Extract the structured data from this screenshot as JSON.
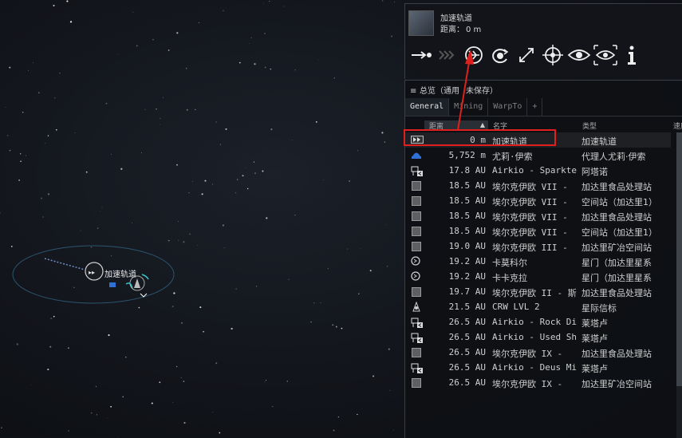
{
  "scene": {
    "label": "加速轨道"
  },
  "selected_item": {
    "name": "加速轨道",
    "distance_label": "距离：",
    "distance_value": "0 m",
    "actions": [
      {
        "name": "approach-icon"
      },
      {
        "name": "align-to-icon"
      },
      {
        "name": "warp-to-icon"
      },
      {
        "name": "orbit-icon"
      },
      {
        "name": "keep-at-range-icon"
      },
      {
        "name": "lock-target-icon"
      },
      {
        "name": "look-at-icon"
      },
      {
        "name": "show-info-eye-icon"
      },
      {
        "name": "info-icon"
      }
    ]
  },
  "overview": {
    "title_prefix": "总览（通用",
    "title_suffix": "未保存）",
    "tabs": [
      "General",
      "Mining",
      "WarpTo",
      "+"
    ],
    "columns": {
      "distance": "距离",
      "name": "名字",
      "type": "类型",
      "speed": "速度"
    },
    "rows": [
      {
        "icon": "acceleration-gate-icon",
        "distance": "0 m",
        "name": "加速轨道",
        "type": "加速轨道"
      },
      {
        "icon": "agent-icon",
        "distance": "5,752 m",
        "name": "尤莉·伊索",
        "type": "代理人尤莉·伊索"
      },
      {
        "icon": "station-structure-icon",
        "distance": "17.8 AU",
        "name": "Airkio - Sparktek In",
        "type": "阿塔诺"
      },
      {
        "icon": "square-icon",
        "distance": "18.5 AU",
        "name": "埃尔克伊欧 VII -",
        "type": "加达里食品处理站"
      },
      {
        "icon": "square-icon",
        "distance": "18.5 AU",
        "name": "埃尔克伊欧 VII -",
        "type": "空间站（加达里1）"
      },
      {
        "icon": "square-icon",
        "distance": "18.5 AU",
        "name": "埃尔克伊欧 VII -",
        "type": "加达里食品处理站"
      },
      {
        "icon": "square-icon",
        "distance": "18.5 AU",
        "name": "埃尔克伊欧 VII -",
        "type": "空间站（加达里1）"
      },
      {
        "icon": "square-icon",
        "distance": "19.0 AU",
        "name": "埃尔克伊欧 III -",
        "type": "加达里矿冶空间站"
      },
      {
        "icon": "stargate-icon",
        "distance": "19.2 AU",
        "name": "卡莫科尔",
        "type": "星门（加达里星系"
      },
      {
        "icon": "stargate-icon",
        "distance": "19.2 AU",
        "name": "卡卡克拉",
        "type": "星门（加达里星系"
      },
      {
        "icon": "square-icon",
        "distance": "19.7 AU",
        "name": "埃尔克伊欧 II - 斯",
        "type": "加达里食品处理站"
      },
      {
        "icon": "beacon-icon",
        "distance": "21.5 AU",
        "name": "CRW LVL 2",
        "type": "星际信标"
      },
      {
        "icon": "station-structure-icon",
        "distance": "26.5 AU",
        "name": "Airkio - Rock Dispe",
        "type": "莱塔卢"
      },
      {
        "icon": "station-structure-icon",
        "distance": "26.5 AU",
        "name": "Airkio - Used Ship",
        "type": "莱塔卢"
      },
      {
        "icon": "square-icon",
        "distance": "26.5 AU",
        "name": "埃尔克伊欧 IX -",
        "type": "加达里食品处理站"
      },
      {
        "icon": "station-structure-icon",
        "distance": "26.5 AU",
        "name": "Airkio - Deus Mine",
        "type": "莱塔卢"
      },
      {
        "icon": "square-icon",
        "distance": "26.5 AU",
        "name": "埃尔克伊欧 IX -",
        "type": "加达里矿冶空间站"
      }
    ]
  },
  "colors": {
    "highlight": "#e0201e",
    "overview_bg": "#0e1014",
    "text": "#cfcfcf"
  }
}
